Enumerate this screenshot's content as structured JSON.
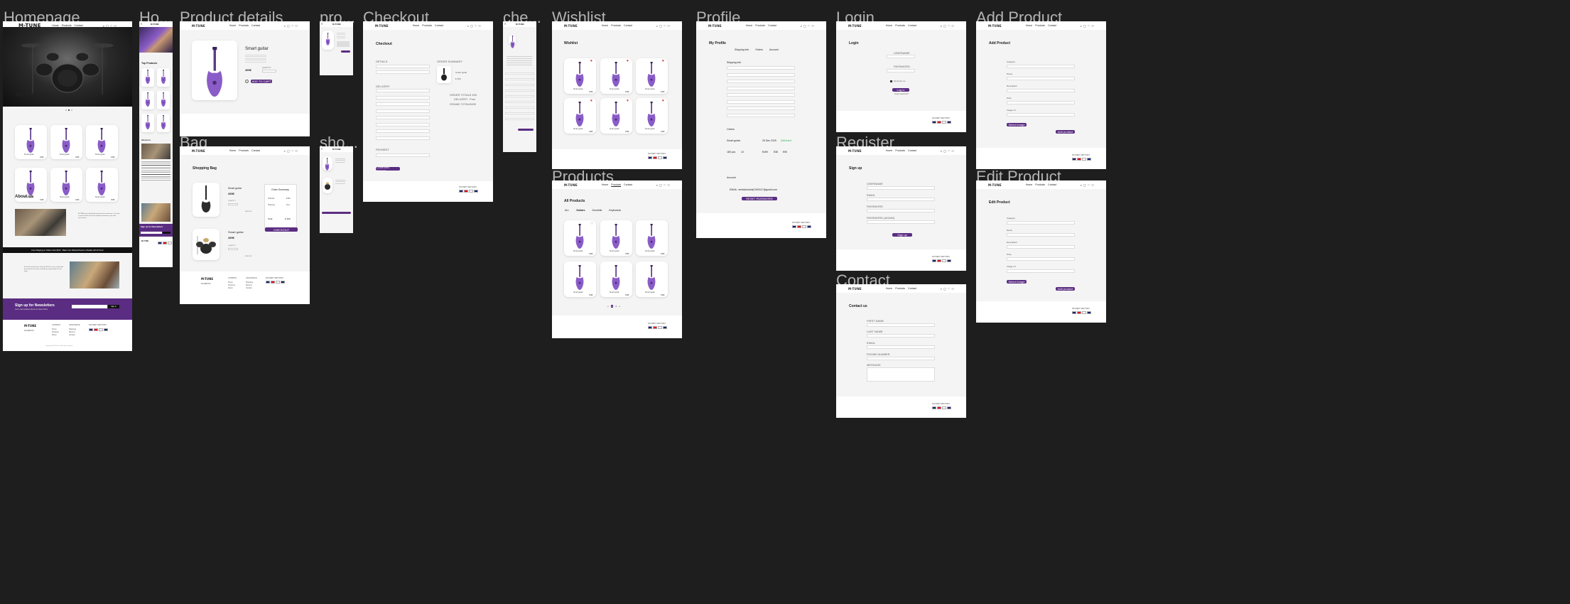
{
  "titles": {
    "homepage": "Homepage",
    "ho_mobile": "Ho...",
    "product_details": "Product details",
    "pro_mobile": "pro...",
    "checkout": "Checkout",
    "che_mobile": "che...",
    "wishlist": "Wishlist",
    "profile": "Profile",
    "login": "Login",
    "add_product": "Add Product",
    "bag": "Bag",
    "sho_mobile": "sho...",
    "products": "Products",
    "register": "Register",
    "edit_product": "Edit Product",
    "contact": "Contact"
  },
  "nav": {
    "logo": "M-TUNE",
    "home": "Home",
    "products": "Products",
    "contact": "Contact",
    "icons": [
      "search-icon",
      "bag-icon",
      "cart-icon",
      "heart-icon",
      "user-icon"
    ]
  },
  "home": {
    "top_products": "Top Products",
    "about_us": "About us",
    "about_text": "M-TUNE was founded by musicians for musicians. Our store is your trusted source for quality instruments, gear and accessories.",
    "banner": "Free Shipping on Orders Over $100 · Make Your Musical Dreams a Reality with M-Tune!",
    "story_text": "From the moment you step into M-Tune, you are greeted by a passion for music shared by every member of our team.",
    "newsletter_title": "Sign up for Newsletters",
    "newsletter_sub": "Get e-mail updates about our latest offers.",
    "newsletter_btn": "Sign in",
    "footer_company": "COMPANY",
    "footer_assistance": "ASSISTANCE",
    "footer_payment": "PAYMENT METHODS",
    "footer_facebook": "FACEBOOK",
    "footer_links": [
      "Home",
      "Products",
      "About"
    ],
    "footer_assist_links": [
      "Shipping",
      "Returns",
      "Contact"
    ],
    "copyright": "Copyright 2025 M-Tune. All rights reserved."
  },
  "product": {
    "name": "Smart guitar",
    "price": "499€",
    "add_to_cart": "ADD TO CART",
    "quantity": "QUANTITY"
  },
  "checkout": {
    "title": "Checkout",
    "details": "DETAILS",
    "delivery": "DELIVERY",
    "payment": "PAYMENT",
    "order_summary": "ORDER SUMMARY",
    "order_total": "ORDER TOTAL",
    "delivery_label": "DELIVERY",
    "grand_total": "GRAND TOTAL",
    "total_val": "€ 499",
    "delivery_val": "Free",
    "grand_val": "€499",
    "confirm_btn": "CONFIRM ORDER"
  },
  "wishlist": {
    "title": "Wishlist"
  },
  "profile": {
    "title": "My Profile",
    "tab_shipping": "Shipping info",
    "tab_orders": "Orders",
    "tab_account": "Account",
    "shipping_info": "Shipping info",
    "orders": "Orders",
    "order_item": "Smart guitar",
    "order_date": "25 Dec 2025",
    "order_status": "Delivered",
    "order_pcs": "180 pcs",
    "order_qty": "10",
    "order_price1": "€499",
    "order_price2": "€38",
    "order_price3": "€95",
    "account": "Account",
    "email": "EMAIL: emilskolodziej7409117@gmail.com",
    "reset_btn": "RESET PASSWORD"
  },
  "login": {
    "title": "Login",
    "username": "USERNAME",
    "password": "PASSWORD",
    "remember": "Remember me",
    "btn": "Log in",
    "forgot": "Forgot password?"
  },
  "register": {
    "title": "Sign up",
    "username": "USERNAME",
    "email": "EMAIL",
    "password": "PASSWORD",
    "password_again": "PASSWORD (again)",
    "btn": "Sign up"
  },
  "contact": {
    "title": "Contact us",
    "first_name": "FIRST NAME",
    "last_name": "LAST NAME",
    "email": "EMAIL",
    "phone": "PHONE NUMBER",
    "message": "MESSAGE"
  },
  "add_product": {
    "title": "Add Product",
    "category": "Category",
    "name": "Name",
    "description": "Description",
    "price": "Price",
    "image_url": "Image url",
    "select_image": "Select image",
    "btn": "Add product"
  },
  "edit_product": {
    "title": "Edit Product",
    "category": "Category",
    "name": "Name",
    "description": "Description",
    "price": "Price",
    "image_url": "Image url",
    "select_image": "Select image",
    "btn": "Add product"
  },
  "products_page": {
    "title": "All Products",
    "filters": [
      "ALL",
      "Guitars",
      "Drumkits",
      "Keyboards"
    ],
    "pages": [
      "«",
      "1",
      "2",
      "»"
    ]
  },
  "bag": {
    "title": "Shopping Bag",
    "summary": "Order Summary",
    "subtotal": "Subtotal",
    "subtotal_val": "€499",
    "shipping": "Shipping",
    "shipping_val": "Free",
    "total": "Total",
    "total_val": "€ 499",
    "checkout_btn": "CHECKOUT",
    "item2_price": "499€",
    "qty": "QUANTITY",
    "remove": "REMOVE"
  },
  "footer": {
    "payment": "PAYMENT METHODS"
  },
  "colors": {
    "brand": "#5b2d82",
    "guitar": "#8a5cc7",
    "heart": "#e0242e",
    "status_green": "#2fb54d"
  }
}
